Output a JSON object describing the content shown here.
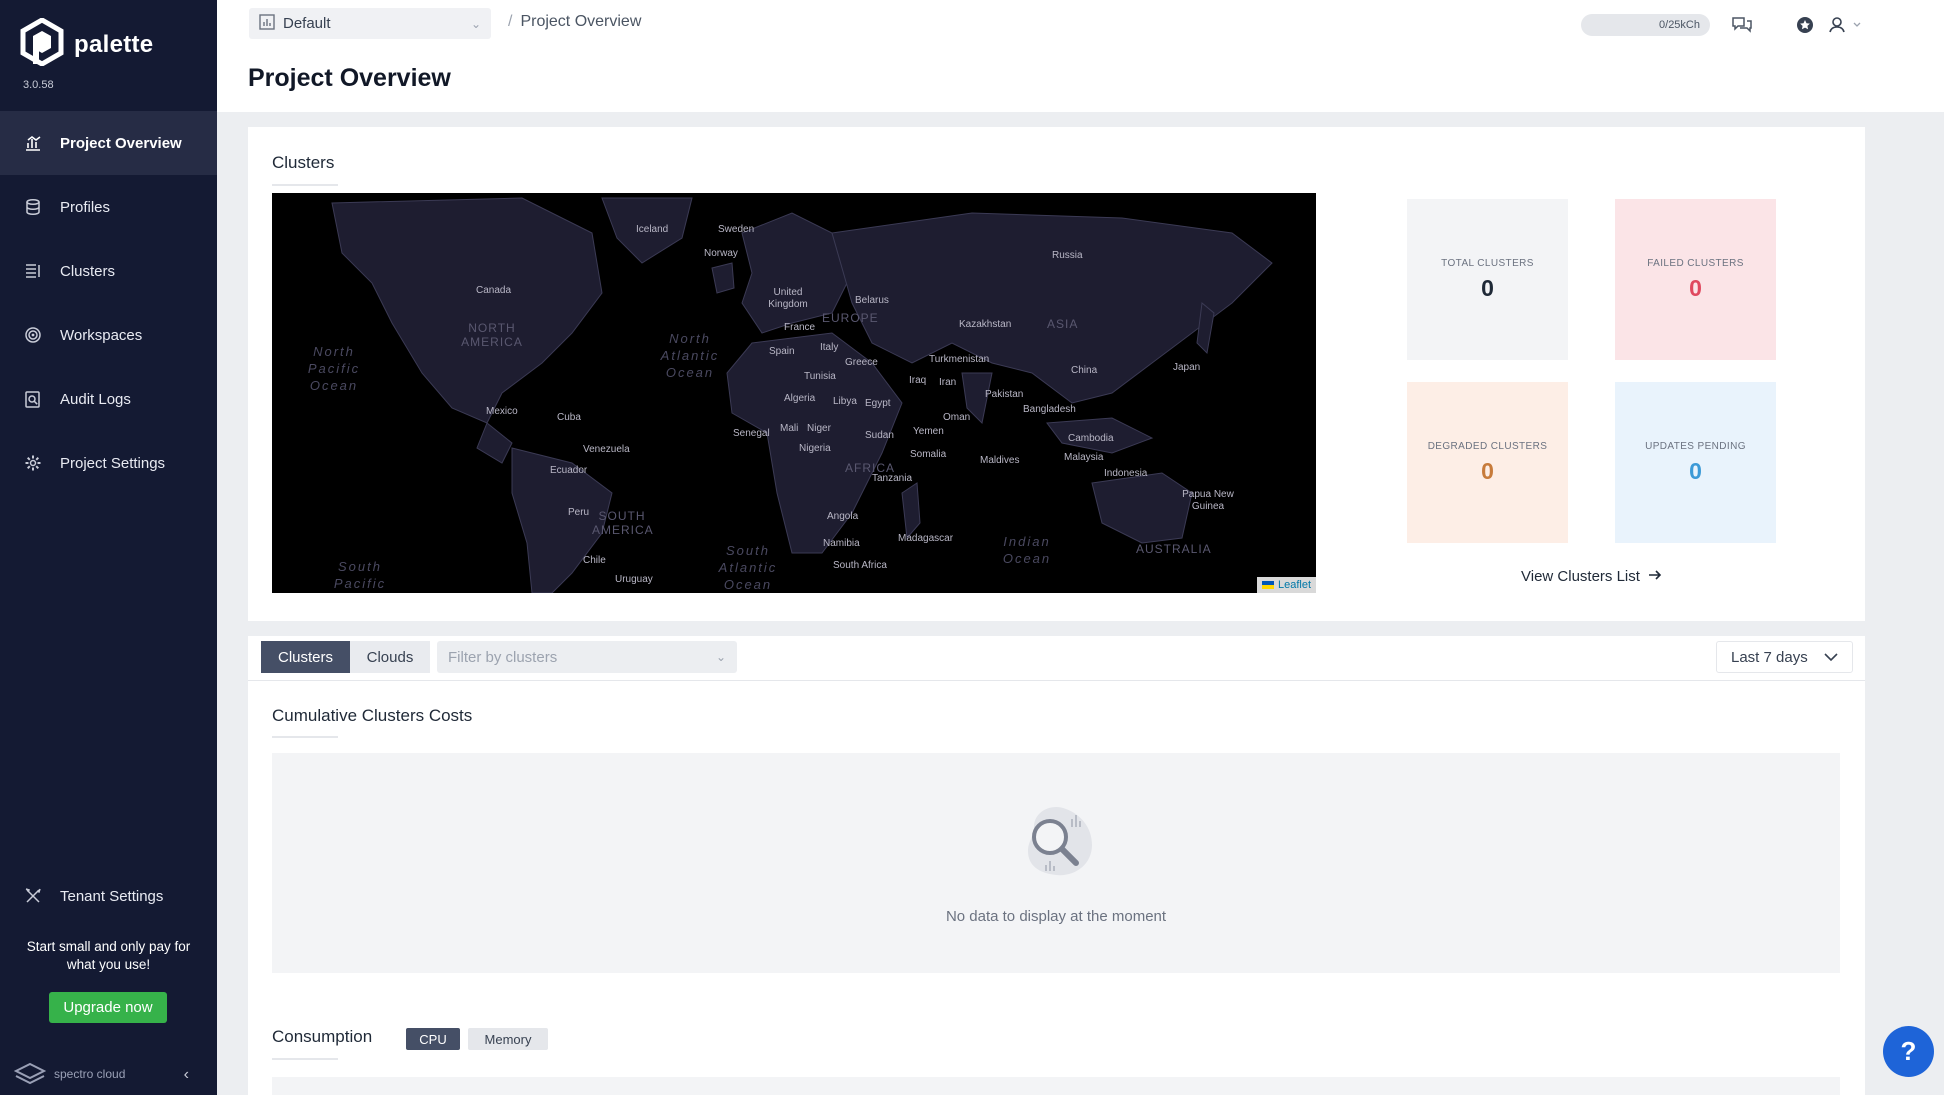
{
  "app": {
    "name": "palette",
    "version": "3.0.58"
  },
  "sidebar": {
    "items": [
      {
        "label": "Project Overview",
        "icon": "chart-icon",
        "active": true
      },
      {
        "label": "Profiles",
        "icon": "stack-icon"
      },
      {
        "label": "Clusters",
        "icon": "list-icon"
      },
      {
        "label": "Workspaces",
        "icon": "workspace-icon"
      },
      {
        "label": "Audit Logs",
        "icon": "audit-icon"
      },
      {
        "label": "Project Settings",
        "icon": "gear-icon"
      }
    ],
    "tenant_settings": "Tenant Settings",
    "promo": "Start small and only pay for what you use!",
    "upgrade_label": "Upgrade now",
    "footer_brand": "spectro cloud"
  },
  "header": {
    "project": "Default",
    "breadcrumb": "Project Overview",
    "title": "Project Overview",
    "usage": "0/25kCh"
  },
  "clusters_section": {
    "title": "Clusters",
    "stats": [
      {
        "label": "TOTAL CLUSTERS",
        "value": "0",
        "bg": "#f3f4f6",
        "color": "#1f2937"
      },
      {
        "label": "FAILED CLUSTERS",
        "value": "0",
        "bg": "#fbe4e7",
        "color": "#e0485f"
      },
      {
        "label": "DEGRADED CLUSTERS",
        "value": "0",
        "bg": "#fdeee6",
        "color": "#c77b3b"
      },
      {
        "label": "UPDATES PENDING",
        "value": "0",
        "bg": "#e9f3fc",
        "color": "#3c9ad7"
      }
    ],
    "view_link": "View Clusters List",
    "map_attribution": "Leaflet",
    "map_labels": {
      "countries": [
        "Iceland",
        "Sweden",
        "Norway",
        "Russia",
        "Canada",
        "United Kingdom",
        "Belarus",
        "France",
        "Kazakhstan",
        "Spain",
        "Italy",
        "Greece",
        "Turkmenistan",
        "China",
        "Japan",
        "Tunisia",
        "Iraq",
        "Iran",
        "Pakistan",
        "Algeria",
        "Libya",
        "Egypt",
        "Mexico",
        "Cuba",
        "Bangladesh",
        "Oman",
        "Senegal",
        "Mali",
        "Niger",
        "Sudan",
        "Yemen",
        "Cambodia",
        "Nigeria",
        "Venezuela",
        "Malaysia",
        "Maldives",
        "Somalia",
        "Ecuador",
        "Indonesia",
        "Tanzania",
        "Papua New Guinea",
        "Peru",
        "Angola",
        "Madagascar",
        "Namibia",
        "Chile",
        "South Africa",
        "Uruguay"
      ],
      "continents": [
        "NORTH AMERICA",
        "EUROPE",
        "ASIA",
        "AFRICA",
        "SOUTH AMERICA",
        "AUSTRALIA"
      ],
      "oceans": [
        "North Pacific Ocean",
        "North Atlantic Ocean",
        "Indian Ocean",
        "South Atlantic Ocean",
        "South Pacific"
      ]
    }
  },
  "costs": {
    "tabs": [
      "Clusters",
      "Clouds"
    ],
    "filter_placeholder": "Filter by clusters",
    "range": "Last 7 days",
    "title": "Cumulative Clusters Costs",
    "empty": "No data to display at the moment"
  },
  "consumption": {
    "title": "Consumption",
    "tabs": [
      "CPU",
      "Memory"
    ]
  },
  "help": "?"
}
